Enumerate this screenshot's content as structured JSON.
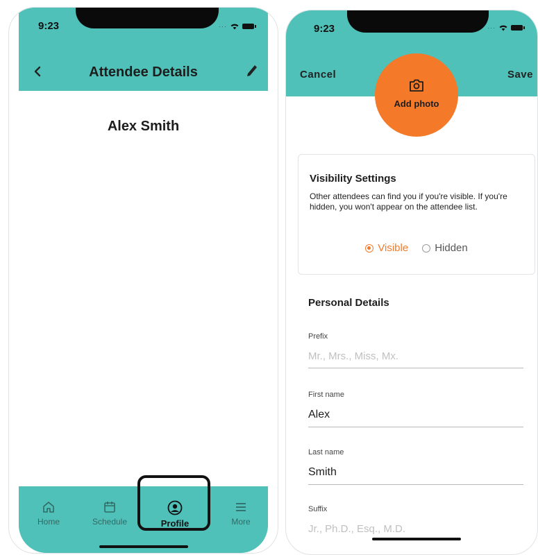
{
  "left_screen": {
    "status": {
      "time": "9:23"
    },
    "header": {
      "title": "Attendee Details"
    },
    "profile": {
      "name": "Alex Smith"
    },
    "tabs": [
      {
        "label": "Home",
        "icon": "home-icon"
      },
      {
        "label": "Schedule",
        "icon": "calendar-icon"
      },
      {
        "label": "Profile",
        "icon": "profile-icon",
        "active": true
      },
      {
        "label": "More",
        "icon": "menu-icon"
      }
    ]
  },
  "right_screen": {
    "status": {
      "time": "9:23"
    },
    "header": {
      "cancel_label": "Cancel",
      "save_label": "Save"
    },
    "photo": {
      "label": "Add photo",
      "icon": "camera-icon"
    },
    "visibility": {
      "title": "Visibility Settings",
      "description": "Other attendees can find you if you're visible. If you're hidden, you won't appear on the attendee list.",
      "options": [
        "Visible",
        "Hidden"
      ],
      "selected": "Visible"
    },
    "personal": {
      "title": "Personal Details",
      "fields": [
        {
          "label": "Prefix",
          "value": "",
          "placeholder": "Mr., Mrs., Miss, Mx."
        },
        {
          "label": "First name",
          "value": "Alex",
          "placeholder": ""
        },
        {
          "label": "Last name",
          "value": "Smith",
          "placeholder": ""
        },
        {
          "label": "Suffix",
          "value": "",
          "placeholder": "Jr., Ph.D., Esq., M.D."
        }
      ]
    }
  },
  "colors": {
    "teal": "#4fc1b9",
    "accent_orange": "#f47929"
  }
}
